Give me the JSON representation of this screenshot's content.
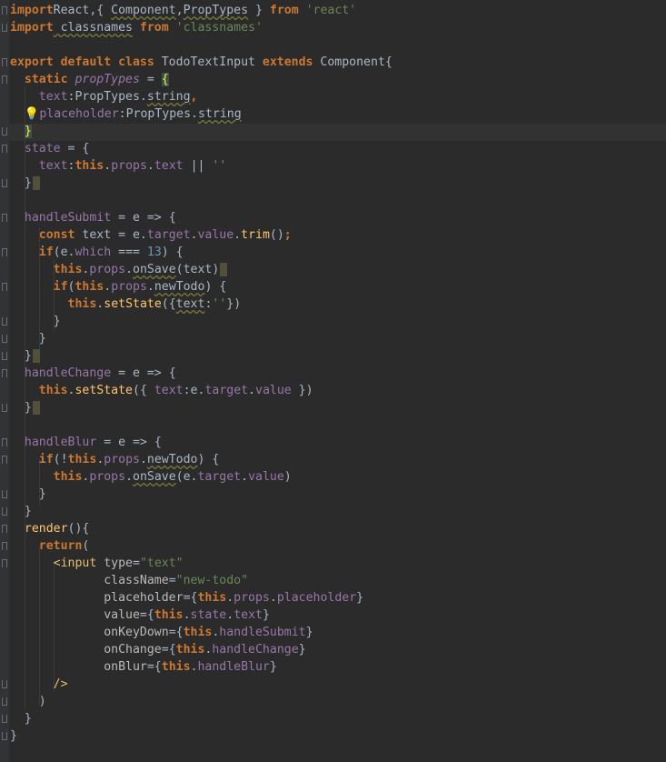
{
  "editor": {
    "language": "javascript",
    "colors": {
      "background": "#2b2b2b",
      "keyword": "#cc7832",
      "string": "#6a8759",
      "number": "#6897bb",
      "property": "#9876aa",
      "tag": "#e8bf6a"
    },
    "lines": [
      {
        "tokens": [
          [
            "kw",
            "import"
          ],
          [
            "",
            "React,{ "
          ],
          [
            "warn",
            "Component"
          ],
          [
            "",
            ","
          ],
          [
            "warn",
            "PropTypes"
          ],
          [
            "",
            " } "
          ],
          [
            "kw",
            "from"
          ],
          [
            "str",
            " 'react'"
          ]
        ]
      },
      {
        "tokens": [
          [
            "kw",
            "import"
          ],
          [
            "warn",
            " classnames"
          ],
          [
            "kw",
            " from"
          ],
          [
            "str",
            " 'classnames'"
          ]
        ]
      },
      {
        "tokens": []
      },
      {
        "tokens": [
          [
            "kw",
            "export default class "
          ],
          [
            "",
            "TodoTextInput "
          ],
          [
            "kw",
            "extends "
          ],
          [
            "",
            "Component{"
          ]
        ]
      },
      {
        "tokens": [
          [
            "",
            "  "
          ],
          [
            "kw",
            "static "
          ],
          [
            "fld",
            "propTypes"
          ],
          [
            "",
            " = "
          ],
          [
            "match",
            "{"
          ]
        ]
      },
      {
        "tokens": [
          [
            "",
            "    "
          ],
          [
            "prop",
            "text"
          ],
          [
            "",
            ":PropTypes."
          ],
          [
            "warn",
            "string"
          ],
          [
            "kw",
            ","
          ]
        ]
      },
      {
        "tokens": [
          [
            "bulb",
            "  💡"
          ],
          [
            "prop",
            "placeholder"
          ],
          [
            "",
            ":PropTypes."
          ],
          [
            "warn",
            "string"
          ]
        ]
      },
      {
        "tokens": [
          [
            "",
            "  "
          ],
          [
            "match",
            "}"
          ]
        ]
      },
      {
        "tokens": [
          [
            "",
            "  "
          ],
          [
            "prop",
            "state"
          ],
          [
            "",
            " = {"
          ]
        ]
      },
      {
        "tokens": [
          [
            "",
            "    "
          ],
          [
            "prop",
            "text"
          ],
          [
            "",
            ":"
          ],
          [
            "kw",
            "this"
          ],
          [
            "",
            "."
          ],
          [
            "prop",
            "props"
          ],
          [
            "",
            "."
          ],
          [
            "prop",
            "text"
          ],
          [
            "",
            " || "
          ],
          [
            "str",
            "''"
          ]
        ]
      },
      {
        "tokens": [
          [
            "",
            "  }"
          ],
          [
            "caret",
            ""
          ]
        ]
      },
      {
        "tokens": []
      },
      {
        "tokens": [
          [
            "",
            "  "
          ],
          [
            "prop",
            "handleSubmit"
          ],
          [
            "",
            " = e => {"
          ]
        ]
      },
      {
        "tokens": [
          [
            "",
            "    "
          ],
          [
            "kw",
            "const "
          ],
          [
            "",
            "text = e."
          ],
          [
            "prop",
            "target"
          ],
          [
            "",
            "."
          ],
          [
            "prop",
            "value"
          ],
          [
            "",
            "."
          ],
          [
            "fn",
            "trim"
          ],
          [
            "",
            "()"
          ],
          [
            "kw",
            ";"
          ]
        ]
      },
      {
        "tokens": [
          [
            "",
            "    "
          ],
          [
            "kw",
            "if"
          ],
          [
            "",
            "(e."
          ],
          [
            "prop",
            "which"
          ],
          [
            "",
            " === "
          ],
          [
            "num",
            "13"
          ],
          [
            "",
            ") {"
          ]
        ]
      },
      {
        "tokens": [
          [
            "",
            "      "
          ],
          [
            "kw",
            "this"
          ],
          [
            "",
            "."
          ],
          [
            "prop",
            "props"
          ],
          [
            "",
            "."
          ],
          [
            "warn",
            "onSave"
          ],
          [
            "",
            "(text)"
          ],
          [
            "caret",
            ""
          ]
        ]
      },
      {
        "tokens": [
          [
            "",
            "      "
          ],
          [
            "kw",
            "if"
          ],
          [
            "",
            "("
          ],
          [
            "kw",
            "this"
          ],
          [
            "",
            "."
          ],
          [
            "prop",
            "props"
          ],
          [
            "",
            "."
          ],
          [
            "warn",
            "newTodo"
          ],
          [
            "",
            ") {"
          ]
        ]
      },
      {
        "tokens": [
          [
            "",
            "        "
          ],
          [
            "kw",
            "this"
          ],
          [
            "",
            "."
          ],
          [
            "fn",
            "setState"
          ],
          [
            "",
            "({"
          ],
          [
            "warn",
            "text"
          ],
          [
            "",
            ":"
          ],
          [
            "str",
            "''"
          ],
          [
            "",
            "})"
          ]
        ]
      },
      {
        "tokens": [
          [
            "",
            "      }"
          ]
        ]
      },
      {
        "tokens": [
          [
            "",
            "    }"
          ]
        ]
      },
      {
        "tokens": [
          [
            "",
            "  }"
          ],
          [
            "caret",
            ""
          ]
        ]
      },
      {
        "tokens": [
          [
            "",
            "  "
          ],
          [
            "prop",
            "handleChange"
          ],
          [
            "",
            " = e => {"
          ]
        ]
      },
      {
        "tokens": [
          [
            "",
            "    "
          ],
          [
            "kw",
            "this"
          ],
          [
            "",
            "."
          ],
          [
            "fn",
            "setState"
          ],
          [
            "",
            "({ "
          ],
          [
            "prop",
            "text"
          ],
          [
            "",
            ":e."
          ],
          [
            "prop",
            "target"
          ],
          [
            "",
            "."
          ],
          [
            "prop",
            "value"
          ],
          [
            "",
            " })"
          ]
        ]
      },
      {
        "tokens": [
          [
            "",
            "  }"
          ],
          [
            "caret",
            ""
          ]
        ]
      },
      {
        "tokens": []
      },
      {
        "tokens": [
          [
            "",
            "  "
          ],
          [
            "prop",
            "handleBlur"
          ],
          [
            "",
            " = e => {"
          ]
        ]
      },
      {
        "tokens": [
          [
            "",
            "    "
          ],
          [
            "kw",
            "if"
          ],
          [
            "",
            "(!"
          ],
          [
            "kw",
            "this"
          ],
          [
            "",
            "."
          ],
          [
            "prop",
            "props"
          ],
          [
            "",
            "."
          ],
          [
            "warn",
            "newTodo"
          ],
          [
            "",
            ") {"
          ]
        ]
      },
      {
        "tokens": [
          [
            "",
            "      "
          ],
          [
            "kw",
            "this"
          ],
          [
            "",
            "."
          ],
          [
            "prop",
            "props"
          ],
          [
            "",
            "."
          ],
          [
            "warn",
            "onSave"
          ],
          [
            "",
            "(e."
          ],
          [
            "prop",
            "target"
          ],
          [
            "",
            "."
          ],
          [
            "prop",
            "value"
          ],
          [
            "",
            ")"
          ]
        ]
      },
      {
        "tokens": [
          [
            "",
            "    }"
          ]
        ]
      },
      {
        "tokens": [
          [
            "",
            "  }"
          ]
        ]
      },
      {
        "tokens": [
          [
            "",
            "  "
          ],
          [
            "fn",
            "render"
          ],
          [
            "",
            "(){"
          ]
        ]
      },
      {
        "tokens": [
          [
            "",
            "    "
          ],
          [
            "kw",
            "return"
          ],
          [
            "",
            "("
          ]
        ]
      },
      {
        "tokens": [
          [
            "",
            "      "
          ],
          [
            "tag",
            "<input "
          ],
          [
            "attr",
            "type"
          ],
          [
            "",
            "="
          ],
          [
            "str",
            "\"text\""
          ]
        ]
      },
      {
        "tokens": [
          [
            "",
            "             "
          ],
          [
            "attr",
            "className"
          ],
          [
            "",
            "="
          ],
          [
            "str",
            "\"new-todo\""
          ]
        ]
      },
      {
        "tokens": [
          [
            "",
            "             "
          ],
          [
            "attr",
            "placeholder"
          ],
          [
            "",
            "={"
          ],
          [
            "kw",
            "this"
          ],
          [
            "",
            "."
          ],
          [
            "prop",
            "props"
          ],
          [
            "",
            "."
          ],
          [
            "prop",
            "placeholder"
          ],
          [
            "",
            "}"
          ]
        ]
      },
      {
        "tokens": [
          [
            "",
            "             "
          ],
          [
            "attr",
            "value"
          ],
          [
            "",
            "={"
          ],
          [
            "kw",
            "this"
          ],
          [
            "",
            "."
          ],
          [
            "prop",
            "state"
          ],
          [
            "",
            "."
          ],
          [
            "prop",
            "text"
          ],
          [
            "",
            "}"
          ]
        ]
      },
      {
        "tokens": [
          [
            "",
            "             "
          ],
          [
            "attr",
            "onKeyDown"
          ],
          [
            "",
            "={"
          ],
          [
            "kw",
            "this"
          ],
          [
            "",
            "."
          ],
          [
            "prop",
            "handleSubmit"
          ],
          [
            "",
            "}"
          ]
        ]
      },
      {
        "tokens": [
          [
            "",
            "             "
          ],
          [
            "attr",
            "onChange"
          ],
          [
            "",
            "={"
          ],
          [
            "kw",
            "this"
          ],
          [
            "",
            "."
          ],
          [
            "prop",
            "handleChange"
          ],
          [
            "",
            "}"
          ]
        ]
      },
      {
        "tokens": [
          [
            "",
            "             "
          ],
          [
            "attr",
            "onBlur"
          ],
          [
            "",
            "={"
          ],
          [
            "kw",
            "this"
          ],
          [
            "",
            "."
          ],
          [
            "prop",
            "handleBlur"
          ],
          [
            "",
            "}"
          ]
        ]
      },
      {
        "tokens": [
          [
            "",
            "      "
          ],
          [
            "tag",
            "/>"
          ]
        ]
      },
      {
        "tokens": [
          [
            "",
            "    )"
          ]
        ]
      },
      {
        "tokens": [
          [
            "",
            "  }"
          ]
        ]
      },
      {
        "tokens": [
          [
            "",
            "}"
          ]
        ]
      }
    ]
  }
}
